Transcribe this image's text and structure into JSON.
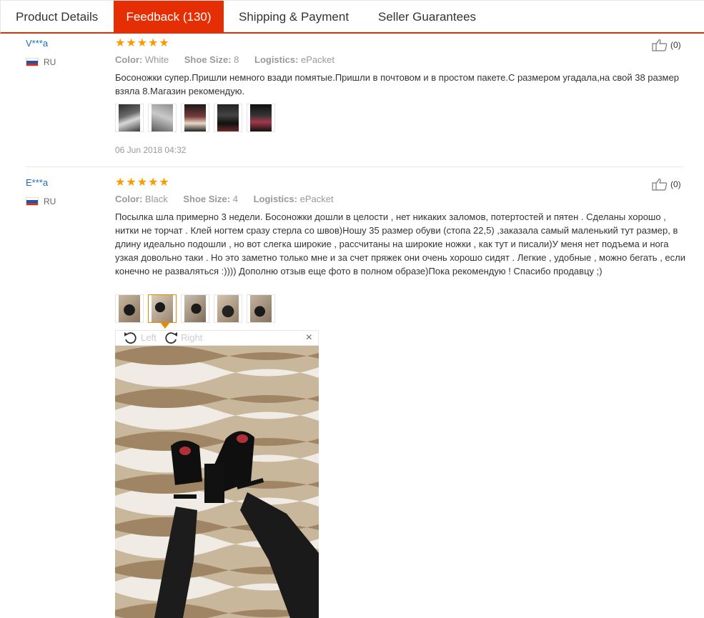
{
  "tabs": [
    {
      "label": "Product Details"
    },
    {
      "label": "Feedback (130)"
    },
    {
      "label": "Shipping & Payment"
    },
    {
      "label": "Seller Guarantees"
    }
  ],
  "colors": {
    "accent": "#e62e04",
    "star": "#ff9900",
    "link": "#1a6bbf"
  },
  "reviews": [
    {
      "user": "V***a",
      "country": "RU",
      "rating": 5,
      "color_label": "Color:",
      "color_value": "White",
      "size_label": "Shoe Size:",
      "size_value": "8",
      "logistics_label": "Logistics:",
      "logistics_value": "ePacket",
      "text": "Босоножки супер.Пришли немного взади помятые.Пришли в почтовом и в простом пакете.С размером угадала,на свой 38 размер взяла 8.Магазин рекомендую.",
      "photo_count": 5,
      "date": "06 Jun 2018 04:32",
      "helpful": "(0)"
    },
    {
      "user": "E***a",
      "country": "RU",
      "rating": 5,
      "color_label": "Color:",
      "color_value": "Black",
      "size_label": "Shoe Size:",
      "size_value": "4",
      "logistics_label": "Logistics:",
      "logistics_value": "ePacket",
      "text": "Посылка шла примерно 3 недели. Босоножки дошли в целости , нет никаких заломов, потертостей и пятен . Сделаны хорошо , нитки не торчат . Клей ногтем сразу стерла со швов)Ношу 35 размер обуви (стопа 22,5) ,заказала самый маленький тут размер, в длину идеально подошли , но вот слегка широкие , рассчитаны на широкие ножки , как тут и писали)У меня нет подъема и нога узкая довольно таки . Но это заметно только мне и за счет пряжек они очень хорошо сидят . Легкие , удобные , можно бегать , если конечно не разваляться :)))) Дополню отзыв еще фото в полном образе)Пока рекомендую ! Спасибо продавцу ;)",
      "photo_count": 5,
      "selected_photo": 2,
      "helpful": "(0)"
    }
  ],
  "viewer": {
    "rotate_left": "Left",
    "rotate_right": "Right",
    "close": "×"
  }
}
